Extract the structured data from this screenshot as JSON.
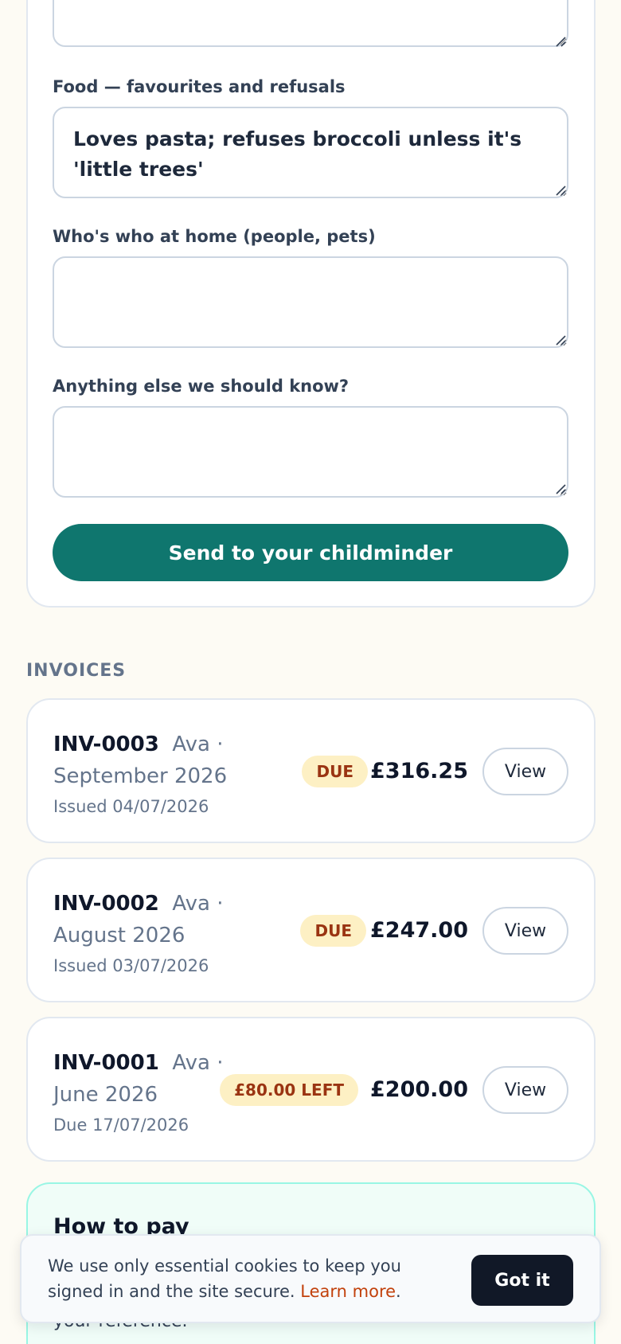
{
  "form": {
    "field_prev": {
      "value": ""
    },
    "food": {
      "label": "Food — favourites and refusals",
      "value": "Loves pasta; refuses broccoli unless it's 'little trees'"
    },
    "household": {
      "label": "Who's who at home (people, pets)",
      "value": ""
    },
    "other": {
      "label": "Anything else we should know?",
      "value": ""
    },
    "submit_label": "Send to your childminder"
  },
  "invoices": {
    "heading": "INVOICES",
    "view_label": "View",
    "items": [
      {
        "id": "INV-0003",
        "desc": "Ava · September 2026",
        "meta": "Issued 04/07/2026",
        "badge": "DUE",
        "amount": "£316.25"
      },
      {
        "id": "INV-0002",
        "desc": "Ava · August 2026",
        "meta": "Issued 03/07/2026",
        "badge": "DUE",
        "amount": "£247.00"
      },
      {
        "id": "INV-0001",
        "desc": "Ava · June 2026",
        "meta": "Due 17/07/2026",
        "badge": "£80.00 LEFT",
        "amount": "£200.00"
      }
    ]
  },
  "payment": {
    "title": "How to pay",
    "body_fragment": "your reference."
  },
  "cookie": {
    "text": "We use only essential cookies to keep you signed in and the site secure.",
    "link": "Learn more",
    "suffix": ".",
    "button": "Got it"
  },
  "colors": {
    "background": "#fdfbf4",
    "primary": "#0f766e",
    "badge_bg": "#fdf0c4",
    "badge_text": "#9a3412",
    "link": "#c2410c"
  }
}
